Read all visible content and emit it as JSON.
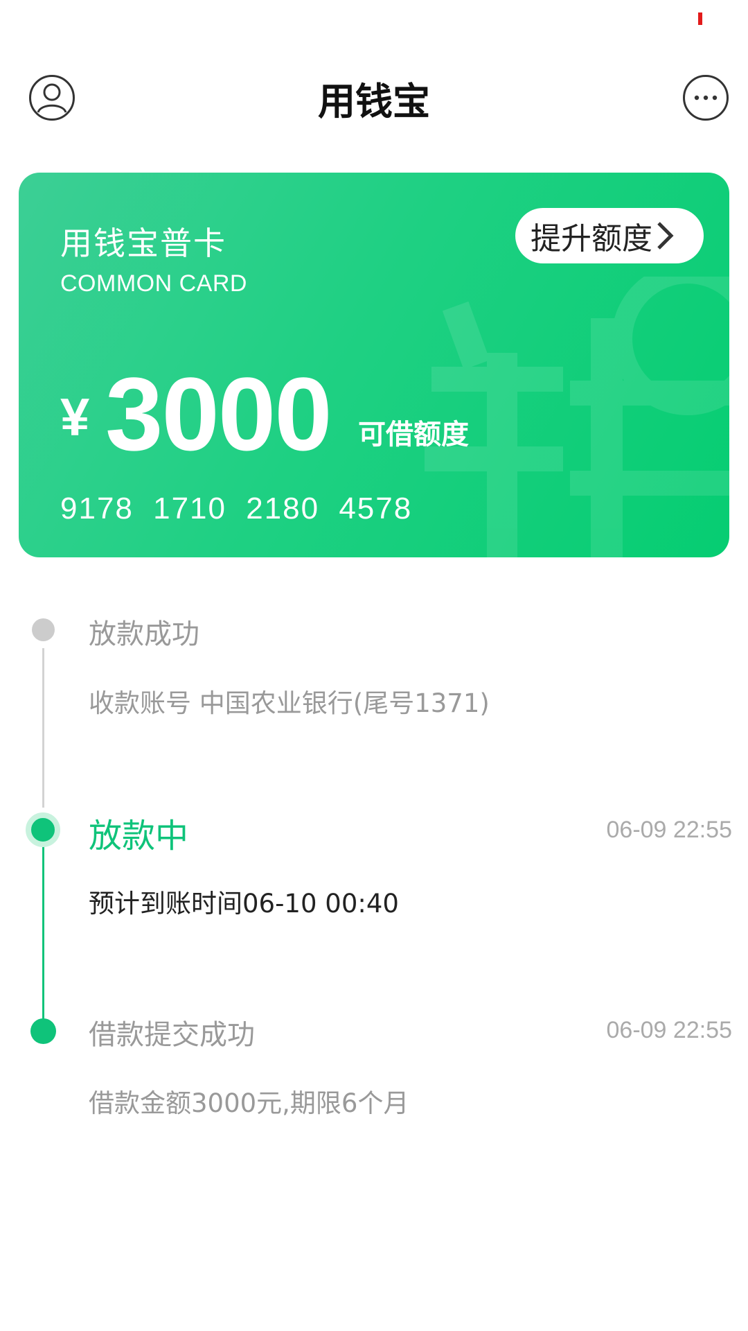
{
  "header": {
    "title": "用钱宝"
  },
  "card": {
    "name": "用钱宝普卡",
    "subtitle": "COMMON CARD",
    "raise_label": "提升额度",
    "currency": "¥",
    "amount": "3000",
    "amount_label": "可借额度",
    "number": "9178 1710 2180 4578"
  },
  "timeline": [
    {
      "title": "放款成功",
      "desc": "收款账号 中国农业银行(尾号1371)",
      "time": "",
      "status": "done"
    },
    {
      "title": "放款中",
      "desc": "预计到账时间06-10 00:40",
      "time": "06-09 22:55",
      "status": "active"
    },
    {
      "title": "借款提交成功",
      "desc": "借款金额3000元,期限6个月",
      "time": "06-09 22:55",
      "status": "complete"
    }
  ],
  "colors": {
    "accent": "#0fc37a",
    "muted": "#999999",
    "text": "#222222"
  }
}
